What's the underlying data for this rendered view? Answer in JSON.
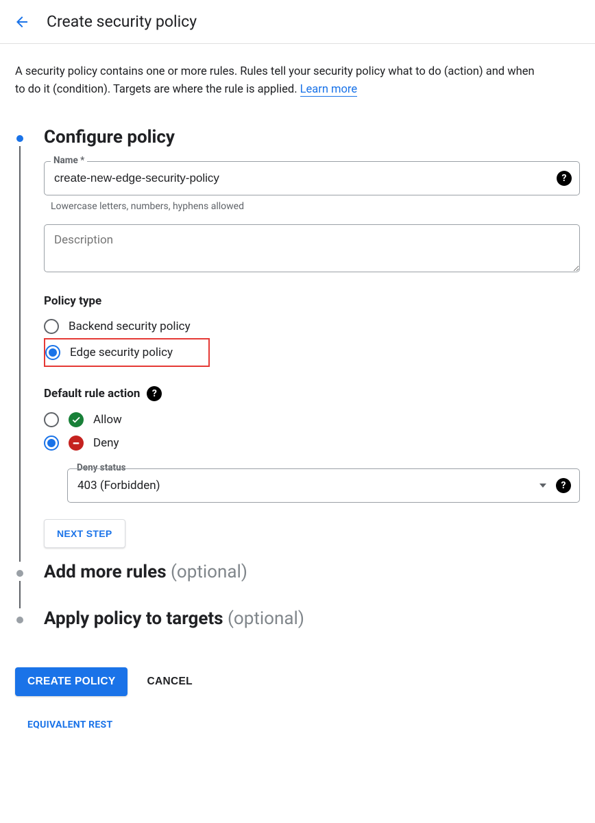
{
  "header": {
    "title": "Create security policy"
  },
  "intro": {
    "text": "A security policy contains one or more rules. Rules tell your security policy what to do (action) and when to do it (condition). Targets are where the rule is applied. ",
    "learn_more": "Learn more"
  },
  "steps": {
    "configure": {
      "title": "Configure policy"
    },
    "add_rules": {
      "title": "Add more rules",
      "optional": "(optional)"
    },
    "apply_targets": {
      "title": "Apply policy to targets",
      "optional": "(optional)"
    }
  },
  "form": {
    "name_label": "Name *",
    "name_value": "create-new-edge-security-policy",
    "name_hint": "Lowercase letters, numbers, hyphens allowed",
    "description_placeholder": "Description",
    "policy_type_label": "Policy type",
    "policy_type_options": {
      "backend": "Backend security policy",
      "edge": "Edge security policy"
    },
    "default_action_label": "Default rule action",
    "default_action_options": {
      "allow": "Allow",
      "deny": "Deny"
    },
    "deny_status_label": "Deny status",
    "deny_status_value": "403 (Forbidden)",
    "next_step": "NEXT STEP"
  },
  "actions": {
    "create": "CREATE POLICY",
    "cancel": "CANCEL",
    "rest": "EQUIVALENT REST"
  }
}
